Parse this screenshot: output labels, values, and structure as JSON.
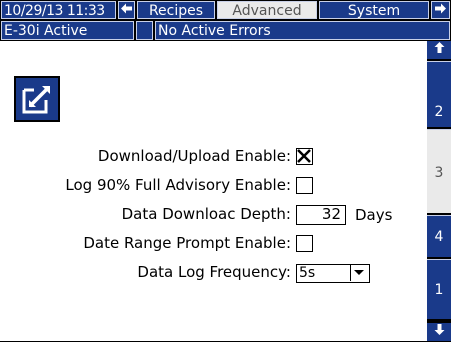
{
  "header": {
    "datetime": "10/29/13 11:33",
    "left_arrow": "🡄",
    "right_arrow": "🡆",
    "tabs": [
      {
        "label": "Recipes",
        "active": false
      },
      {
        "label": "Advanced",
        "active": true
      },
      {
        "label": "System",
        "active": false
      }
    ]
  },
  "status": {
    "unit": "E-30i Active",
    "errors": "No Active Errors"
  },
  "form": {
    "download_upload_label": "Download/Upload Enable:",
    "download_upload_checked": true,
    "log90_label": "Log 90% Full Advisory Enable:",
    "log90_checked": false,
    "depth_label": "Data Downloac Depth:",
    "depth_value": "32",
    "depth_unit": "Days",
    "date_range_label": "Date Range Prompt Enable:",
    "date_range_checked": false,
    "frequency_label": "Data Log Frequency:",
    "frequency_value": "5s"
  },
  "side_nav": {
    "up_arrow": "🡅",
    "down_arrow": "🡇",
    "pages": [
      {
        "label": "2",
        "active": false
      },
      {
        "label": "3",
        "active": true
      },
      {
        "label": "4",
        "active": false
      },
      {
        "label": "1",
        "active": false
      }
    ]
  },
  "colors": {
    "accent": "#1a3a8a",
    "active_tab": "#eaeaea"
  }
}
